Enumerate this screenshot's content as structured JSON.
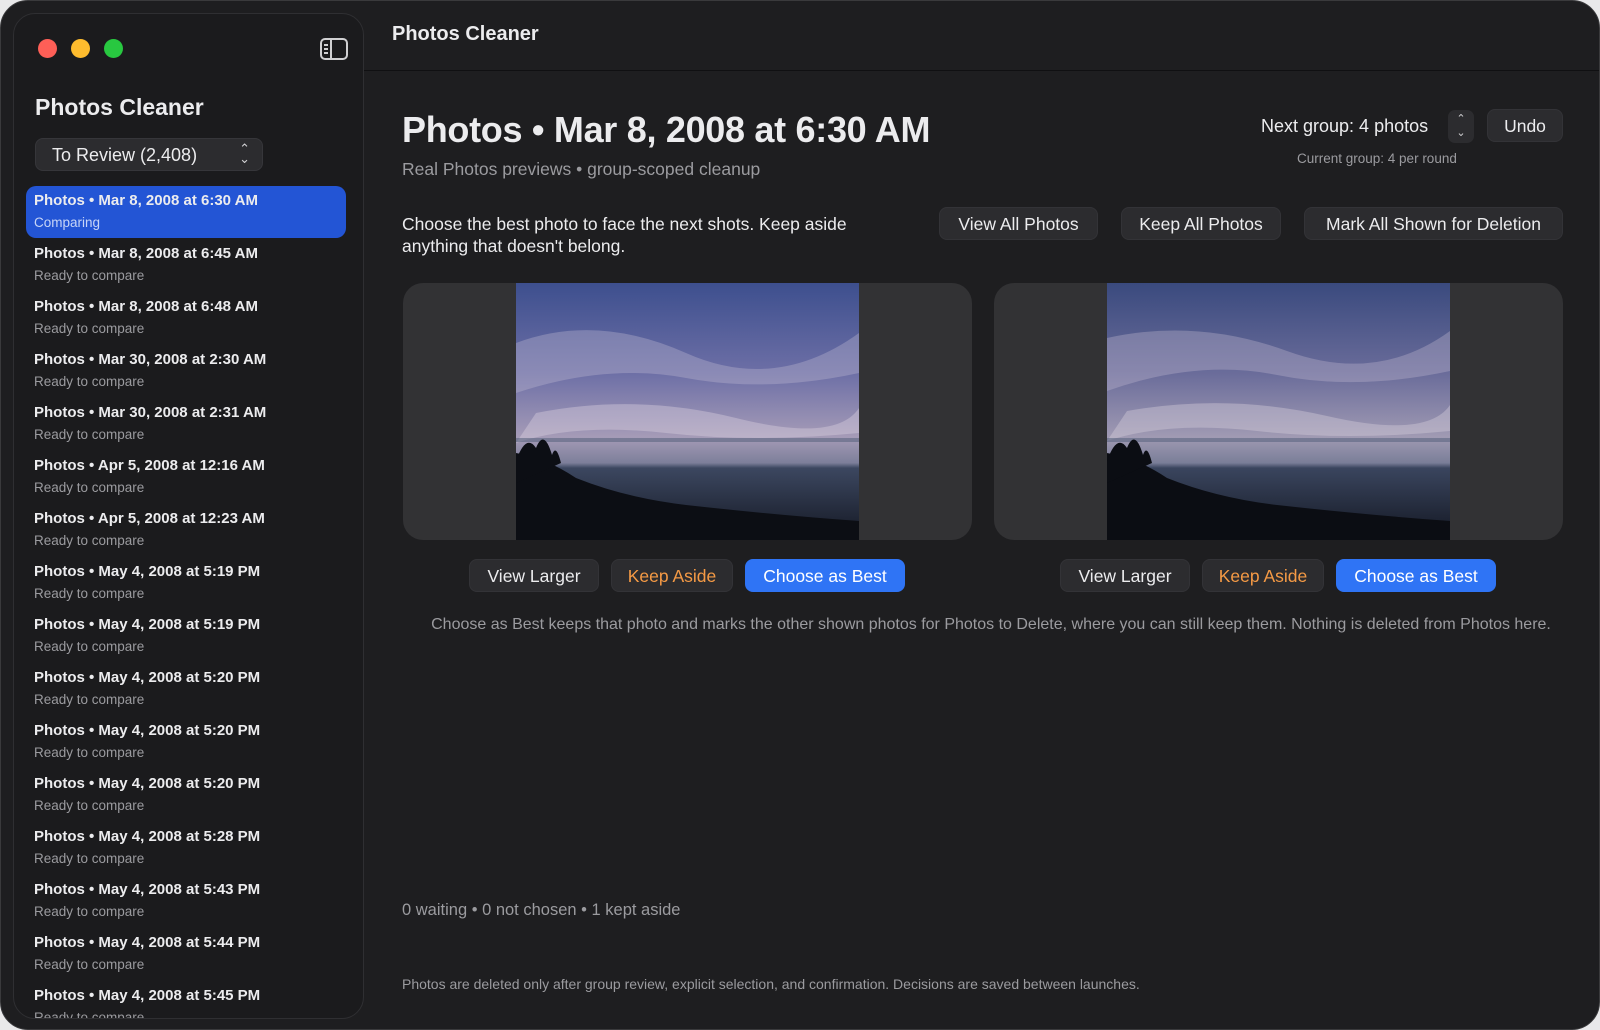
{
  "app": {
    "title": "Photos Cleaner"
  },
  "sidebar": {
    "title": "Photos Cleaner",
    "filter": {
      "selected": "To Review (2,408)"
    },
    "items": [
      {
        "title": "Photos • Mar 8, 2008 at 6:30 AM",
        "status": "Comparing",
        "selected": true
      },
      {
        "title": "Photos • Mar 8, 2008 at 6:45 AM",
        "status": "Ready to compare"
      },
      {
        "title": "Photos • Mar 8, 2008 at 6:48 AM",
        "status": "Ready to compare"
      },
      {
        "title": "Photos • Mar 30, 2008 at 2:30 AM",
        "status": "Ready to compare"
      },
      {
        "title": "Photos • Mar 30, 2008 at 2:31 AM",
        "status": "Ready to compare"
      },
      {
        "title": "Photos • Apr 5, 2008 at 12:16 AM",
        "status": "Ready to compare"
      },
      {
        "title": "Photos • Apr 5, 2008 at 12:23 AM",
        "status": "Ready to compare"
      },
      {
        "title": "Photos • May 4, 2008 at 5:19 PM",
        "status": "Ready to compare"
      },
      {
        "title": "Photos • May 4, 2008 at 5:19 PM",
        "status": "Ready to compare"
      },
      {
        "title": "Photos • May 4, 2008 at 5:20 PM",
        "status": "Ready to compare"
      },
      {
        "title": "Photos • May 4, 2008 at 5:20 PM",
        "status": "Ready to compare"
      },
      {
        "title": "Photos • May 4, 2008 at 5:20 PM",
        "status": "Ready to compare"
      },
      {
        "title": "Photos • May 4, 2008 at 5:28 PM",
        "status": "Ready to compare"
      },
      {
        "title": "Photos • May 4, 2008 at 5:43 PM",
        "status": "Ready to compare"
      },
      {
        "title": "Photos • May 4, 2008 at 5:44 PM",
        "status": "Ready to compare"
      },
      {
        "title": "Photos • May 4, 2008 at 5:45 PM",
        "status": "Ready to compare"
      }
    ]
  },
  "main": {
    "title": "Photos • Mar 8, 2008 at 6:30 AM",
    "subtitle": "Real Photos previews • group-scoped cleanup",
    "next_group": "Next group: 4 photos",
    "current_group": "Current group: 4 per round",
    "undo_label": "Undo",
    "instructions": "Choose the best photo to face the next shots. Keep aside anything that doesn't belong.",
    "view_all_label": "View All Photos",
    "keep_all_label": "Keep All Photos",
    "mark_all_label": "Mark All Shown for Deletion",
    "photos": [
      {
        "view_larger": "View Larger",
        "keep_aside": "Keep Aside",
        "choose_best": "Choose as Best"
      },
      {
        "view_larger": "View Larger",
        "keep_aside": "Keep Aside",
        "choose_best": "Choose as Best"
      }
    ],
    "explainer": "Choose as Best keeps that photo and marks the other shown photos for Photos to Delete, where you can still keep them. Nothing is deleted from Photos here.",
    "status": "0 waiting • 0 not chosen • 1 kept aside",
    "footer": "Photos are deleted only after group review, explicit selection, and confirmation. Decisions are saved between launches."
  },
  "colors": {
    "accent": "#2f74f5",
    "selection": "#2355d5",
    "keep_aside": "#f59a45",
    "background": "#1e1e20"
  },
  "icons": [
    "sidebar-toggle-icon",
    "chevron-up-down-icon"
  ]
}
